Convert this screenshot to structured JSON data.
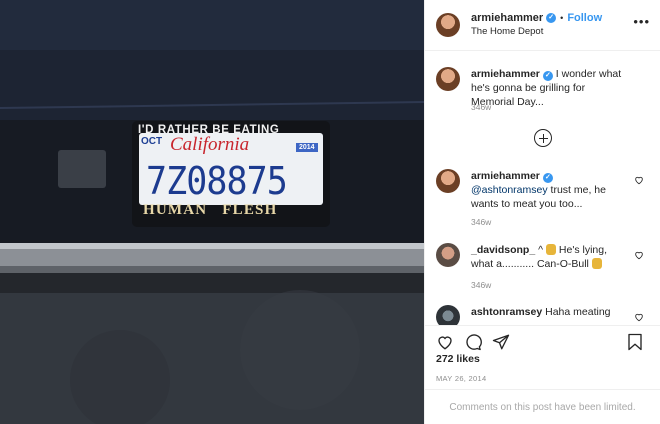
{
  "photo": {
    "plate_top": "I'D RATHER BE  EATING",
    "plate_month": "OCT",
    "plate_state": "California",
    "plate_year": "2014",
    "plate_number": "7Z08875",
    "plate_bottom": "HUMAN  FLESH"
  },
  "header": {
    "username": "armiehammer",
    "follow_label": "Follow",
    "location": "The Home Depot",
    "dot": "•",
    "more_icon": "more-options-icon",
    "more_glyph": "•••"
  },
  "comments": [
    {
      "user": "armiehammer",
      "verified": true,
      "text": "I wonder what he's gonna be grilling for Memorial Day...",
      "age": "346w"
    },
    {
      "user": "armiehammer",
      "verified": true,
      "mention": "@ashtonramsey",
      "text": "trust me, he wants to meat you too...",
      "age": "346w"
    },
    {
      "user": "_davidsonp_",
      "text_before": "^",
      "text_mid": "He's lying, what a........... Can-O-Bull",
      "age": "346w"
    },
    {
      "user": "ashtonramsey",
      "text": "Haha meating"
    }
  ],
  "icons": {
    "like": "heart-icon",
    "comment": "comment-icon",
    "share": "share-icon",
    "save": "bookmark-icon",
    "load_more": "plus-circle-icon"
  },
  "actions": {
    "likes": "272 likes",
    "date": "MAY 26, 2014"
  },
  "footer": {
    "text": "Comments on this post have been limited."
  }
}
